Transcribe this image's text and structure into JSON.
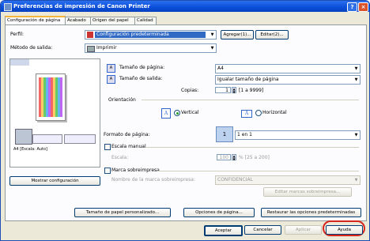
{
  "window": {
    "title": "Preferencias de impresión de Canon Printer",
    "help_glyph": "?",
    "close_glyph": "×"
  },
  "tabs": [
    "Configuración de página",
    "Acabado",
    "Origen del papel",
    "Calidad"
  ],
  "profile": {
    "label": "Perfil:",
    "value": "Configuración predeterminada",
    "add_button": "Agregar(1)...",
    "edit_button": "Editar(2)..."
  },
  "output_method": {
    "label": "Método de salida:",
    "value": "Imprimir"
  },
  "preview": {
    "caption": "A4 [Escala: Auto]",
    "show_config_button": "Mostrar configuración"
  },
  "page_size": {
    "label": "Tamaño de página:",
    "value": "A4"
  },
  "output_size": {
    "label": "Tamaño de salida:",
    "value": "Igualar tamaño de página"
  },
  "copies": {
    "label": "Copias:",
    "value": "1",
    "range": "[1 a 9999]"
  },
  "orientation": {
    "label": "Orientación",
    "vertical": "Vertical",
    "horizontal": "Horizontal",
    "selected": "Vertical"
  },
  "page_layout": {
    "label": "Formato de página:",
    "value": "1 en 1",
    "icon_text": "1"
  },
  "scaling": {
    "label": "Escala manual",
    "sub_label": "Escala:",
    "value": "100",
    "range": "% [25 a 200]"
  },
  "watermark": {
    "label": "Marca sobreimpresa",
    "name_label": "Nombre de la marca sobreimpresa:",
    "value": "CONFIDENCIAL",
    "edit_button": "Editar marcas sobreimpresa..."
  },
  "bottom_buttons": {
    "custom_paper": "Tamaño de papel personalizado...",
    "page_options": "Opciones de página...",
    "restore_defaults": "Restaurar las opciones predeterminadas"
  },
  "dialog_buttons": {
    "ok": "Aceptar",
    "cancel": "Cancelar",
    "apply": "Aplicar",
    "help": "Ayuda"
  },
  "colors": {
    "title_bar": "#0a4ed8",
    "tab_highlight": "#f3b53b",
    "help_highlight": "#d9261c",
    "selection": "#316ac5"
  }
}
